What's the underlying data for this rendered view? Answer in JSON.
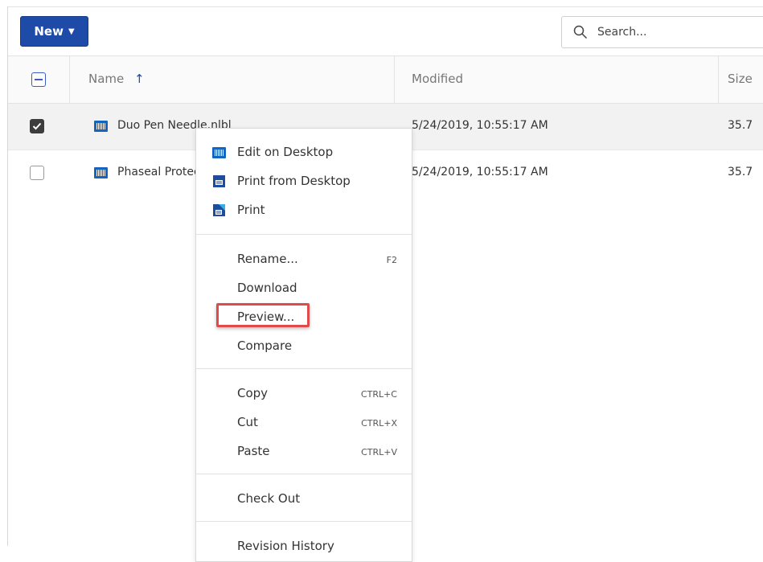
{
  "toolbar": {
    "new_label": "New",
    "search_placeholder": "Search..."
  },
  "table": {
    "columns": [
      "Name",
      "Modified",
      "Size"
    ],
    "sort_indicator": "↑",
    "rows": [
      {
        "name": "Duo Pen Needle.nlbl",
        "modified": "5/24/2019, 10:55:17 AM",
        "size": "35.7",
        "selected": true
      },
      {
        "name": "Phaseal Protector.nlbl",
        "modified": "5/24/2019, 10:55:17 AM",
        "size": "35.7",
        "selected": false
      }
    ]
  },
  "context_menu": {
    "groups": [
      [
        {
          "label": "Edit on Desktop",
          "icon": "barcode-label-icon"
        },
        {
          "label": "Print from Desktop",
          "icon": "print-desktop-icon"
        },
        {
          "label": "Print",
          "icon": "print-icon"
        }
      ],
      [
        {
          "label": "Rename...",
          "shortcut": "F2"
        },
        {
          "label": "Download"
        },
        {
          "label": "Preview..."
        },
        {
          "label": "Compare"
        }
      ],
      [
        {
          "label": "Copy",
          "shortcut": "CTRL+C"
        },
        {
          "label": "Cut",
          "shortcut": "CTRL+X"
        },
        {
          "label": "Paste",
          "shortcut": "CTRL+V"
        }
      ],
      [
        {
          "label": "Check Out"
        }
      ],
      [
        {
          "label": "Revision History"
        }
      ]
    ]
  },
  "colors": {
    "accent": "#1e4aa8",
    "file_icon": "#1565c0",
    "highlight": "#e04a4a"
  }
}
